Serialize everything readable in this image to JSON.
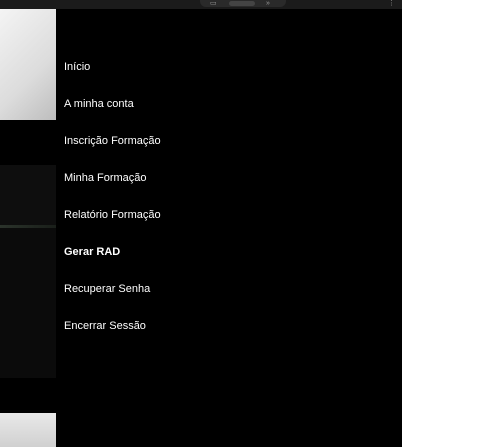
{
  "browser": {
    "icons": [
      "copy-icon",
      "chevron-icon"
    ]
  },
  "menu": {
    "items": [
      {
        "label": "Início",
        "active": false
      },
      {
        "label": "A minha conta",
        "active": false
      },
      {
        "label": "Inscrição Formação",
        "active": false
      },
      {
        "label": "Minha Formação",
        "active": false
      },
      {
        "label": "Relatório Formação",
        "active": false
      },
      {
        "label": "Gerar RAD",
        "active": true
      },
      {
        "label": "Recuperar Senha",
        "active": false
      },
      {
        "label": "Encerrar Sessão",
        "active": false
      }
    ]
  },
  "colors": {
    "menu_background": "#000000",
    "menu_text": "#ffffff"
  }
}
